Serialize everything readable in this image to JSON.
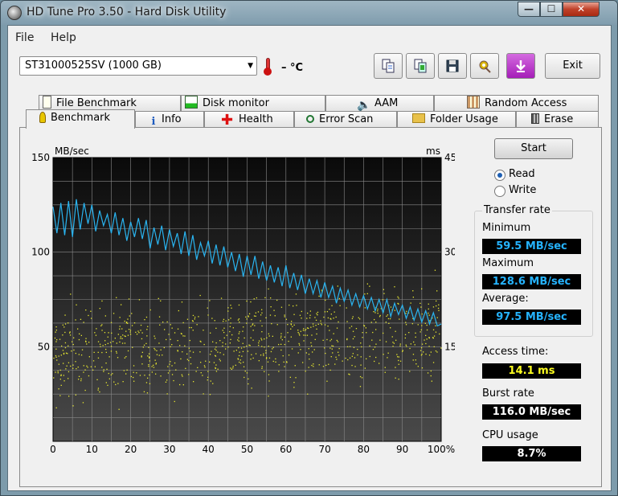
{
  "window": {
    "title": "HD Tune Pro 3.50 - Hard Disk Utility"
  },
  "menu": [
    {
      "label": "File"
    },
    {
      "label": "Help"
    }
  ],
  "drive": {
    "selected": "ST31000525SV (1000 GB)"
  },
  "temperature": {
    "text": "– °C"
  },
  "toolbar": {
    "icons": [
      "copy-text-icon",
      "copy-screenshot-icon",
      "save-icon",
      "options-icon",
      "download-icon"
    ],
    "exit_label": "Exit"
  },
  "tabs_top": [
    {
      "label": "File Benchmark",
      "icon": "file-benchmark-icon"
    },
    {
      "label": "Disk monitor",
      "icon": "disk-monitor-icon"
    },
    {
      "label": "AAM",
      "icon": "speaker-icon"
    },
    {
      "label": "Random Access",
      "icon": "random-access-icon"
    }
  ],
  "tabs_bottom": [
    {
      "label": "Benchmark",
      "icon": "benchmark-icon",
      "active": true
    },
    {
      "label": "Info",
      "icon": "info-icon"
    },
    {
      "label": "Health",
      "icon": "health-icon"
    },
    {
      "label": "Error Scan",
      "icon": "error-scan-icon"
    },
    {
      "label": "Folder Usage",
      "icon": "folder-icon"
    },
    {
      "label": "Erase",
      "icon": "trash-icon"
    }
  ],
  "controls": {
    "start_label": "Start",
    "read_label": "Read",
    "write_label": "Write",
    "mode": "read"
  },
  "transfer_rate": {
    "group_label": "Transfer rate",
    "minimum_label": "Minimum",
    "minimum_value": "59.5 MB/sec",
    "maximum_label": "Maximum",
    "maximum_value": "128.6 MB/sec",
    "average_label": "Average:",
    "average_value": "97.5 MB/sec"
  },
  "access_time": {
    "label": "Access time:",
    "value": "14.1 ms"
  },
  "burst_rate": {
    "label": "Burst rate",
    "value": "116.0 MB/sec"
  },
  "cpu_usage": {
    "label": "CPU usage",
    "value": "8.7%"
  },
  "colors": {
    "transfer_line": "#2ab4f0",
    "access_points": "#e8e830",
    "plot_bg_top": "#0a0a0a",
    "plot_bg_bottom": "#4a4a4a"
  },
  "chart_data": {
    "type": "line",
    "ylabel": "MB/sec",
    "y2label": "ms",
    "xlim": [
      0,
      100
    ],
    "ylim": [
      0,
      150
    ],
    "y2lim": [
      0,
      45
    ],
    "x_ticks": [
      "0",
      "10",
      "20",
      "30",
      "40",
      "50",
      "60",
      "70",
      "80",
      "90",
      "100%"
    ],
    "y_ticks": [
      "150",
      "100",
      "50"
    ],
    "y2_ticks": [
      "45",
      "30",
      "15"
    ],
    "grid": true,
    "series": [
      {
        "x": [
          0,
          1,
          2,
          3,
          4,
          5,
          6,
          7,
          8,
          9,
          10,
          11,
          12,
          13,
          14,
          15,
          16,
          17,
          18,
          19,
          20,
          21,
          22,
          23,
          24,
          25,
          26,
          27,
          28,
          29,
          30,
          31,
          32,
          33,
          34,
          35,
          36,
          37,
          38,
          39,
          40,
          41,
          42,
          43,
          44,
          45,
          46,
          47,
          48,
          49,
          50,
          51,
          52,
          53,
          54,
          55,
          56,
          57,
          58,
          59,
          60,
          61,
          62,
          63,
          64,
          65,
          66,
          67,
          68,
          69,
          70,
          71,
          72,
          73,
          74,
          75,
          76,
          77,
          78,
          79,
          80,
          81,
          82,
          83,
          84,
          85,
          86,
          87,
          88,
          89,
          90,
          91,
          92,
          93,
          94,
          95,
          96,
          97,
          98,
          99,
          100
        ],
        "values": [
          124,
          110,
          126,
          109,
          127,
          108,
          128,
          112,
          126,
          115,
          125,
          111,
          122,
          114,
          120,
          110,
          121,
          109,
          118,
          106,
          116,
          108,
          118,
          107,
          117,
          102,
          113,
          104,
          114,
          101,
          112,
          103,
          110,
          99,
          111,
          98,
          109,
          96,
          105,
          98,
          106,
          94,
          104,
          93,
          103,
          92,
          100,
          90,
          99,
          87,
          98,
          88,
          98,
          86,
          95,
          85,
          93,
          84,
          92,
          82,
          93,
          81,
          89,
          80,
          88,
          78,
          86,
          78,
          85,
          76,
          84,
          76,
          82,
          73,
          81,
          74,
          80,
          72,
          78,
          71,
          77,
          70,
          76,
          69,
          75,
          68,
          75,
          66,
          73,
          67,
          72,
          65,
          71,
          64,
          70,
          63,
          69,
          62,
          68,
          61,
          62
        ]
      }
    ],
    "access_scatter": {
      "note": "yellow points, y in ms (right axis), ~10-25 ms spread",
      "count": 900,
      "x_range": [
        0,
        100
      ],
      "y_range_ms": [
        10,
        25
      ]
    }
  }
}
